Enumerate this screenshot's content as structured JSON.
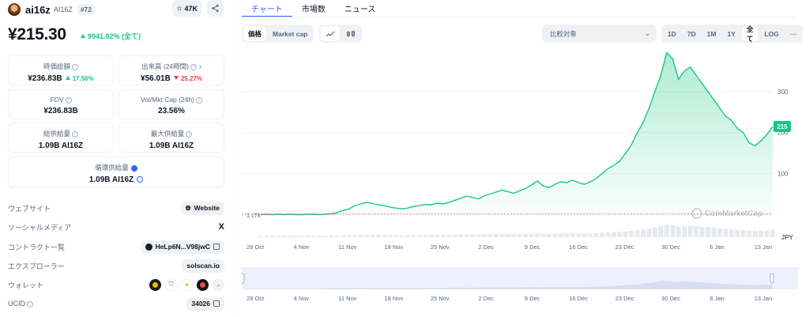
{
  "coin": {
    "name": "ai16z",
    "symbol": "AI16Z",
    "rank": "#72",
    "watch_count": "47K",
    "price": "¥215.30",
    "change": "9941.02% (全て)"
  },
  "stats": {
    "market_cap": {
      "label": "時価総額",
      "value": "¥236.83B",
      "change": "17.56%"
    },
    "volume": {
      "label": "出来高 (24時間)",
      "value": "¥56.01B",
      "change": "25.27%"
    },
    "fdv": {
      "label": "FDV",
      "value": "¥236.83B"
    },
    "vol_mkt_cap": {
      "label": "Vol/Mkt Cap (24h)",
      "value": "23.56%"
    },
    "total_supply": {
      "label": "総供給量",
      "value": "1.09B AI16Z"
    },
    "max_supply": {
      "label": "最大供給量",
      "value": "1.09B AI16Z"
    },
    "circ_supply": {
      "label": "循環供給量",
      "value": "1.09B AI16Z"
    }
  },
  "links": {
    "website": {
      "label": "ウェブサイト",
      "value": "Website"
    },
    "social": {
      "label": "ソーシャルメディア",
      "value": "X"
    },
    "contract": {
      "label": "コントラクト一覧",
      "value": "HeLp6N...V98jwC"
    },
    "explorer": {
      "label": "エクスプローラー",
      "value": "solscan.io"
    },
    "wallet": {
      "label": "ウォレット"
    },
    "ucid": {
      "label": "UCID",
      "value": "34026"
    }
  },
  "tabs": [
    {
      "label": "チャート",
      "active": true
    },
    {
      "label": "市場数",
      "active": false
    },
    {
      "label": "ニュース",
      "active": false
    }
  ],
  "toolbar": {
    "metric_price": "価格",
    "metric_mcap": "Market cap",
    "compare_placeholder": "比較対象",
    "ranges": [
      "1D",
      "7D",
      "1M",
      "1Y",
      "全て"
    ],
    "active_range": "全て",
    "log": "LOG",
    "more": "···"
  },
  "chart_data": {
    "type": "area",
    "currency_label": "JPY",
    "y_ticks": [
      100,
      200,
      300
    ],
    "ylim": [
      -55,
      400
    ],
    "baseline_value": 1.178,
    "baseline_label": "1.178",
    "current_value": 215,
    "current_label": "215",
    "x_ticks": [
      "28 Oct",
      "4 Nov",
      "11 Nov",
      "18 Nov",
      "25 Nov",
      "2 Dec",
      "9 Dec",
      "16 Dec",
      "23 Dec",
      "30 Dec",
      "6 Jan",
      "13 Jan"
    ],
    "watermark": "CoinMarketCap",
    "colors": {
      "line": "#16c784",
      "current_badge": "#16c784",
      "baseline": "#ea3943"
    },
    "series": [
      {
        "values": [
          0,
          1,
          0,
          1,
          0,
          1,
          0,
          0,
          1,
          1,
          0,
          1,
          2,
          5,
          10,
          14,
          22,
          26,
          30,
          27,
          24,
          22,
          18,
          16,
          14,
          16,
          20,
          22,
          25,
          24,
          28,
          26,
          30,
          35,
          40,
          45,
          42,
          38,
          46,
          50,
          55,
          60,
          56,
          52,
          58,
          64,
          72,
          82,
          70,
          66,
          74,
          80,
          78,
          84,
          78,
          74,
          80,
          88,
          100,
          112,
          120,
          130,
          150,
          170,
          200,
          225,
          260,
          300,
          340,
          395,
          380,
          330,
          350,
          360,
          340,
          320,
          300,
          280,
          260,
          240,
          230,
          210,
          200,
          175,
          168,
          180,
          195,
          215
        ]
      }
    ]
  }
}
